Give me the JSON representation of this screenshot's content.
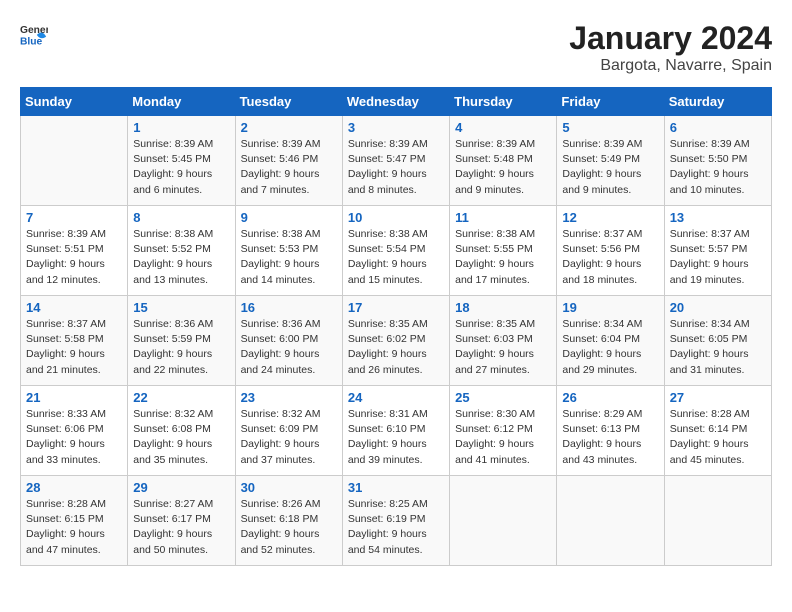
{
  "logo": {
    "general": "General",
    "blue": "Blue"
  },
  "title": "January 2024",
  "subtitle": "Bargota, Navarre, Spain",
  "days_of_week": [
    "Sunday",
    "Monday",
    "Tuesday",
    "Wednesday",
    "Thursday",
    "Friday",
    "Saturday"
  ],
  "weeks": [
    [
      {
        "day": "",
        "info": ""
      },
      {
        "day": "1",
        "info": "Sunrise: 8:39 AM\nSunset: 5:45 PM\nDaylight: 9 hours\nand 6 minutes."
      },
      {
        "day": "2",
        "info": "Sunrise: 8:39 AM\nSunset: 5:46 PM\nDaylight: 9 hours\nand 7 minutes."
      },
      {
        "day": "3",
        "info": "Sunrise: 8:39 AM\nSunset: 5:47 PM\nDaylight: 9 hours\nand 8 minutes."
      },
      {
        "day": "4",
        "info": "Sunrise: 8:39 AM\nSunset: 5:48 PM\nDaylight: 9 hours\nand 9 minutes."
      },
      {
        "day": "5",
        "info": "Sunrise: 8:39 AM\nSunset: 5:49 PM\nDaylight: 9 hours\nand 9 minutes."
      },
      {
        "day": "6",
        "info": "Sunrise: 8:39 AM\nSunset: 5:50 PM\nDaylight: 9 hours\nand 10 minutes."
      }
    ],
    [
      {
        "day": "7",
        "info": "Sunrise: 8:39 AM\nSunset: 5:51 PM\nDaylight: 9 hours\nand 12 minutes."
      },
      {
        "day": "8",
        "info": "Sunrise: 8:38 AM\nSunset: 5:52 PM\nDaylight: 9 hours\nand 13 minutes."
      },
      {
        "day": "9",
        "info": "Sunrise: 8:38 AM\nSunset: 5:53 PM\nDaylight: 9 hours\nand 14 minutes."
      },
      {
        "day": "10",
        "info": "Sunrise: 8:38 AM\nSunset: 5:54 PM\nDaylight: 9 hours\nand 15 minutes."
      },
      {
        "day": "11",
        "info": "Sunrise: 8:38 AM\nSunset: 5:55 PM\nDaylight: 9 hours\nand 17 minutes."
      },
      {
        "day": "12",
        "info": "Sunrise: 8:37 AM\nSunset: 5:56 PM\nDaylight: 9 hours\nand 18 minutes."
      },
      {
        "day": "13",
        "info": "Sunrise: 8:37 AM\nSunset: 5:57 PM\nDaylight: 9 hours\nand 19 minutes."
      }
    ],
    [
      {
        "day": "14",
        "info": "Sunrise: 8:37 AM\nSunset: 5:58 PM\nDaylight: 9 hours\nand 21 minutes."
      },
      {
        "day": "15",
        "info": "Sunrise: 8:36 AM\nSunset: 5:59 PM\nDaylight: 9 hours\nand 22 minutes."
      },
      {
        "day": "16",
        "info": "Sunrise: 8:36 AM\nSunset: 6:00 PM\nDaylight: 9 hours\nand 24 minutes."
      },
      {
        "day": "17",
        "info": "Sunrise: 8:35 AM\nSunset: 6:02 PM\nDaylight: 9 hours\nand 26 minutes."
      },
      {
        "day": "18",
        "info": "Sunrise: 8:35 AM\nSunset: 6:03 PM\nDaylight: 9 hours\nand 27 minutes."
      },
      {
        "day": "19",
        "info": "Sunrise: 8:34 AM\nSunset: 6:04 PM\nDaylight: 9 hours\nand 29 minutes."
      },
      {
        "day": "20",
        "info": "Sunrise: 8:34 AM\nSunset: 6:05 PM\nDaylight: 9 hours\nand 31 minutes."
      }
    ],
    [
      {
        "day": "21",
        "info": "Sunrise: 8:33 AM\nSunset: 6:06 PM\nDaylight: 9 hours\nand 33 minutes."
      },
      {
        "day": "22",
        "info": "Sunrise: 8:32 AM\nSunset: 6:08 PM\nDaylight: 9 hours\nand 35 minutes."
      },
      {
        "day": "23",
        "info": "Sunrise: 8:32 AM\nSunset: 6:09 PM\nDaylight: 9 hours\nand 37 minutes."
      },
      {
        "day": "24",
        "info": "Sunrise: 8:31 AM\nSunset: 6:10 PM\nDaylight: 9 hours\nand 39 minutes."
      },
      {
        "day": "25",
        "info": "Sunrise: 8:30 AM\nSunset: 6:12 PM\nDaylight: 9 hours\nand 41 minutes."
      },
      {
        "day": "26",
        "info": "Sunrise: 8:29 AM\nSunset: 6:13 PM\nDaylight: 9 hours\nand 43 minutes."
      },
      {
        "day": "27",
        "info": "Sunrise: 8:28 AM\nSunset: 6:14 PM\nDaylight: 9 hours\nand 45 minutes."
      }
    ],
    [
      {
        "day": "28",
        "info": "Sunrise: 8:28 AM\nSunset: 6:15 PM\nDaylight: 9 hours\nand 47 minutes."
      },
      {
        "day": "29",
        "info": "Sunrise: 8:27 AM\nSunset: 6:17 PM\nDaylight: 9 hours\nand 50 minutes."
      },
      {
        "day": "30",
        "info": "Sunrise: 8:26 AM\nSunset: 6:18 PM\nDaylight: 9 hours\nand 52 minutes."
      },
      {
        "day": "31",
        "info": "Sunrise: 8:25 AM\nSunset: 6:19 PM\nDaylight: 9 hours\nand 54 minutes."
      },
      {
        "day": "",
        "info": ""
      },
      {
        "day": "",
        "info": ""
      },
      {
        "day": "",
        "info": ""
      }
    ]
  ]
}
